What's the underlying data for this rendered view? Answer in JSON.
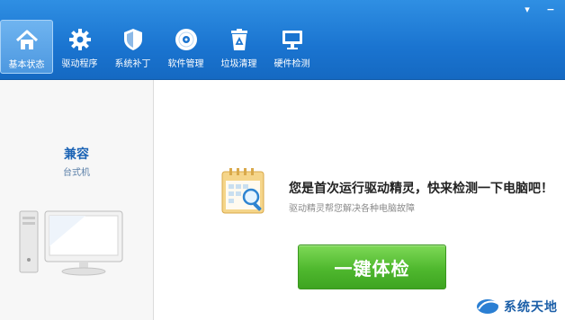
{
  "window_controls": {
    "menu": "▾",
    "minimize": "−"
  },
  "nav": {
    "items": [
      {
        "label": "基本状态",
        "icon": "home-icon",
        "active": true
      },
      {
        "label": "驱动程序",
        "icon": "gear-icon",
        "active": false
      },
      {
        "label": "系统补丁",
        "icon": "shield-icon",
        "active": false
      },
      {
        "label": "软件管理",
        "icon": "disc-icon",
        "active": false
      },
      {
        "label": "垃圾清理",
        "icon": "recycle-bin-icon",
        "active": false
      },
      {
        "label": "硬件检测",
        "icon": "monitor-icon",
        "active": false
      }
    ]
  },
  "sidebar": {
    "device_name": "兼容",
    "device_type": "台式机"
  },
  "main": {
    "headline": "您是首次运行驱动精灵，快来检测一下电脑吧！",
    "subline": "驱动精灵帮您解决各种电脑故障",
    "check_button": "一键体检"
  },
  "watermark": {
    "text": "系统天地"
  },
  "colors": {
    "topbar": "#1a74d0",
    "button_green": "#4fb82e",
    "device_blue": "#1b63b5"
  }
}
